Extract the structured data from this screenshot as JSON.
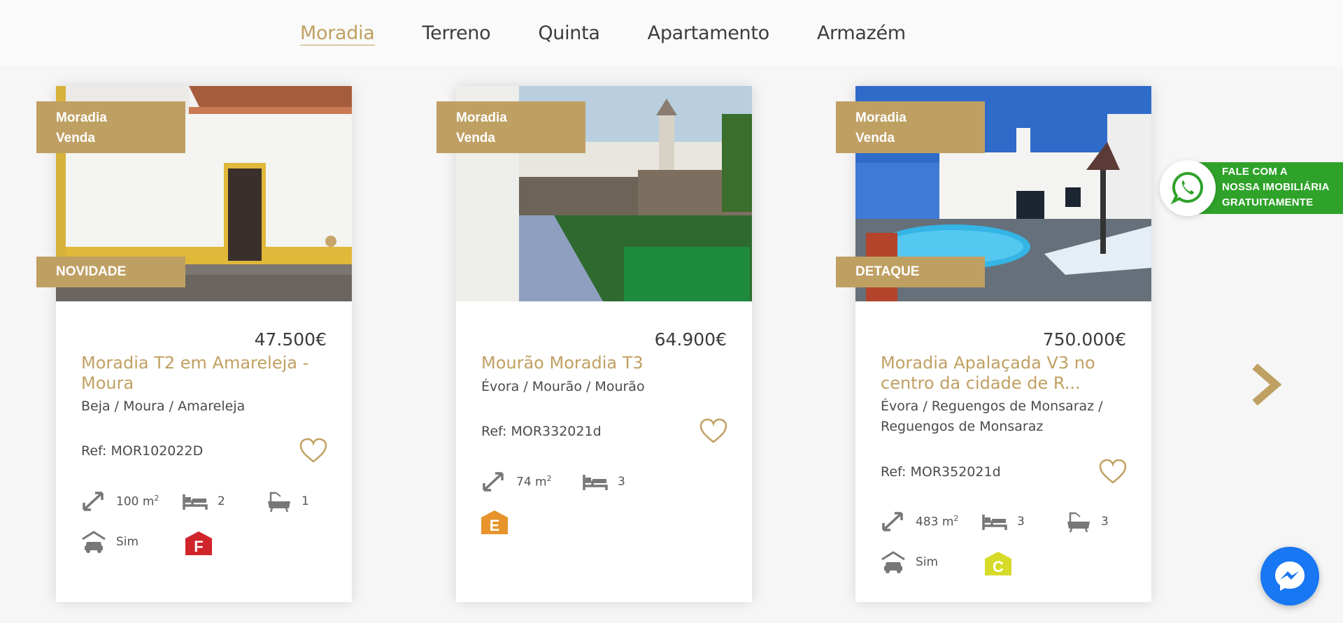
{
  "tabs": [
    {
      "label": "Moradia",
      "active": true
    },
    {
      "label": "Terreno",
      "active": false
    },
    {
      "label": "Quinta",
      "active": false
    },
    {
      "label": "Apartamento",
      "active": false
    },
    {
      "label": "Armazém",
      "active": false
    }
  ],
  "cards": [
    {
      "type": "Moradia",
      "deal": "Venda",
      "badge": "NOVIDADE",
      "price": "47.500€",
      "title": "Moradia T2 em Amareleja - Moura",
      "location": "Beja / Moura / Amareleja",
      "ref": "Ref: MOR102022D",
      "area": "100 m",
      "area_sup": "2",
      "bedrooms": "2",
      "bathrooms": "1",
      "garage": "Sim",
      "energy": "F",
      "energy_color": "#d0252b"
    },
    {
      "type": "Moradia",
      "deal": "Venda",
      "badge": "",
      "price": "64.900€",
      "title": "Mourão Moradia T3",
      "location": "Évora / Mourão / Mourão",
      "ref": "Ref: MOR332021d",
      "area": "74 m",
      "area_sup": "2",
      "bedrooms": "3",
      "energy": "E",
      "energy_color": "#e6942b"
    },
    {
      "type": "Moradia",
      "deal": "Venda",
      "badge": "DETAQUE",
      "price": "750.000€",
      "title": "Moradia Apalaçada V3 no centro da cidade de R...",
      "location": "Évora / Reguengos de Monsaraz / Reguengos de Monsaraz",
      "ref": "Ref: MOR352021d",
      "area": "483 m",
      "area_sup": "2",
      "bedrooms": "3",
      "bathrooms": "3",
      "garage": "Sim",
      "energy": "C",
      "energy_color": "#d6db2a"
    }
  ],
  "whatsapp": {
    "line1": "FALE COM A",
    "line2": "NOSSA IMOBILIÁRIA",
    "line3": "GRATUITAMENTE",
    "color": "#2fa22a"
  },
  "colors": {
    "accent": "#c0a062",
    "messenger": "#1877f2"
  },
  "icons": {
    "heart": "heart-outline-icon",
    "area": "resize-arrows-icon",
    "bed": "bed-icon",
    "bath": "bathtub-icon",
    "garage": "car-garage-icon",
    "next": "chevron-right-icon",
    "whatsapp": "whatsapp-icon",
    "messenger": "messenger-icon"
  }
}
